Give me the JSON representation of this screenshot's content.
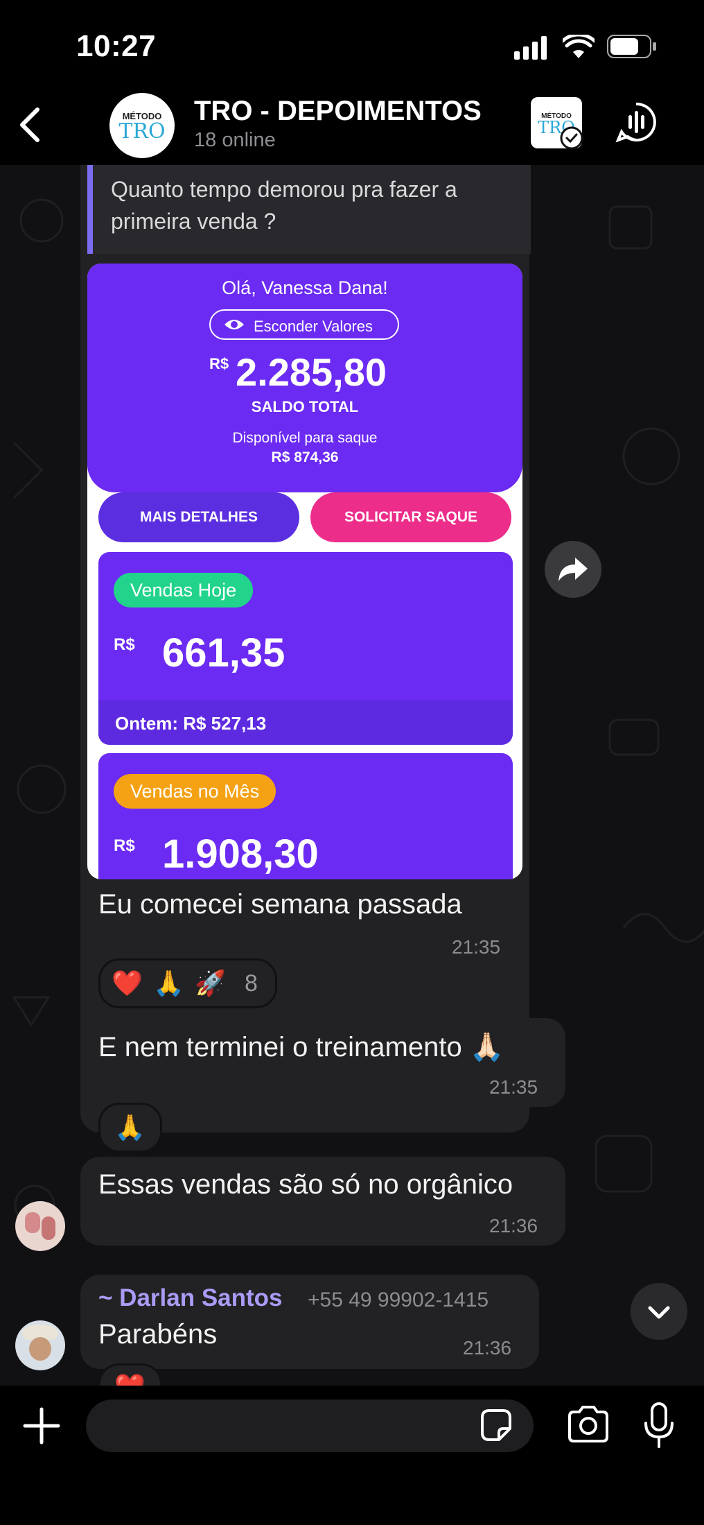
{
  "status_bar": {
    "time": "10:27"
  },
  "header": {
    "avatar_text_top": "MÉTODO",
    "avatar_text_bottom": "TRO",
    "title": "TRO - DEPOIMENTOS",
    "subtitle": "18 online"
  },
  "chat": {
    "quote": {
      "text_line1": "Quanto tempo demorou pra fazer a",
      "text_line2": "primeira venda ?"
    },
    "screenshot": {
      "greeting": "Olá, Vanessa Dana!",
      "hide_button": "Esconder Valores",
      "currency": "R$",
      "balance": "2.285,80",
      "balance_label": "SALDO TOTAL",
      "available_label": "Disponível para saque",
      "available_value": "R$ 874,36",
      "details_button": "MAIS DETALHES",
      "withdraw_button": "SOLICITAR SAQUE",
      "card_today": {
        "pill": "Vendas Hoje",
        "currency": "R$",
        "value": "661,35",
        "footer": "Ontem: R$ 527,13"
      },
      "card_month": {
        "pill": "Vendas no Mês",
        "currency": "R$",
        "value": "1.908,30"
      }
    },
    "messages": [
      {
        "text": "Eu comecei semana passada",
        "time": "21:35"
      },
      {
        "text": "E nem terminei o treinamento 🙏🏻",
        "time": "21:35"
      },
      {
        "text": "Essas vendas são só no orgânico",
        "time": "21:36"
      },
      {
        "sender": "~ Darlan Santos",
        "phone": "+55 49 99902-1415",
        "text": "Parabéns",
        "time": "21:36"
      }
    ],
    "reactions_1": {
      "emojis": [
        "❤️",
        "🙏",
        "🚀"
      ],
      "count": "8"
    },
    "reactions_2": {
      "emojis": [
        "🙏"
      ]
    },
    "reactions_3": {
      "emojis": [
        "❤️"
      ]
    }
  },
  "colors": {
    "accent_purple": "#6b2bf2",
    "pink": "#ec2d8a",
    "green_pill": "#22d38b",
    "orange_pill": "#f5a114",
    "sender_name": "#a99cf5"
  }
}
